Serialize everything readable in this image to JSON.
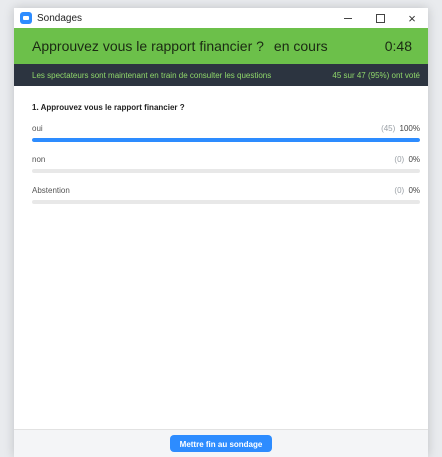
{
  "window": {
    "title": "Sondages",
    "close_glyph": "×"
  },
  "header": {
    "question": "Approuvez vous le rapport financier ?",
    "status": "en cours",
    "timer": "0:48",
    "background_color": "#6cc04a"
  },
  "info_bar": {
    "text": "Les spectateurs sont maintenant en train de consulter les questions",
    "count": "45 sur 47 (95%) ont voté"
  },
  "question": {
    "title": "1. Approuvez vous le rapport financier ?"
  },
  "answers": [
    {
      "label": "oui",
      "count": "(45)",
      "percent": "100%",
      "fraction": 1.0
    },
    {
      "label": "non",
      "count": "(0)",
      "percent": "0%",
      "fraction": 0.0
    },
    {
      "label": "Abstention",
      "count": "(0)",
      "percent": "0%",
      "fraction": 0.0
    }
  ],
  "footer": {
    "end_button_label": "Mettre fin au sondage"
  },
  "colors": {
    "accent": "#2d8cff",
    "header_green": "#6cc04a",
    "info_bar_bg": "#2c3440",
    "info_text": "#8fd76a"
  },
  "icons": {
    "app": "zoom-camera-icon",
    "minimize": "minimize-icon",
    "maximize": "maximize-icon",
    "close": "close-icon"
  }
}
